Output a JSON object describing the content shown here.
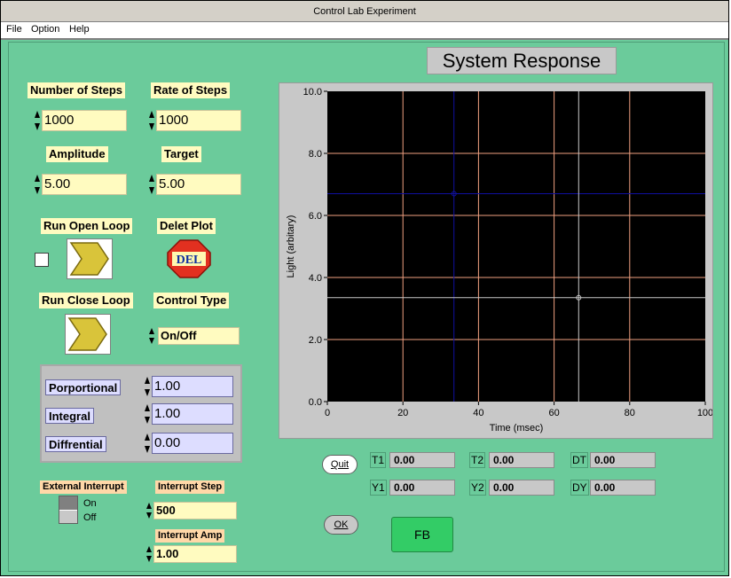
{
  "window": {
    "title": "Control Lab Experiment"
  },
  "menu": [
    "File",
    "Option",
    "Help"
  ],
  "controls": {
    "num_steps": {
      "label": "Number of Steps",
      "value": "1000"
    },
    "rate_steps": {
      "label": "Rate of Steps",
      "value": "1000"
    },
    "amplitude": {
      "label": "Amplitude",
      "value": "5.00"
    },
    "target": {
      "label": "Target",
      "value": "5.00"
    },
    "run_open_loop": {
      "label": "Run Open Loop"
    },
    "delet_plot": {
      "label": "Delet Plot",
      "icon_text": "DEL"
    },
    "run_close_loop": {
      "label": "Run Close Loop"
    },
    "control_type": {
      "label": "Control Type",
      "value": "On/Off"
    },
    "proportional": {
      "label": "Porportional",
      "value": "1.00"
    },
    "integral": {
      "label": "Integral",
      "value": "1.00"
    },
    "differential": {
      "label": "Diffrential",
      "value": "0.00"
    },
    "external_interrupt": {
      "label": "External Interrupt",
      "on_label": "On",
      "off_label": "Off"
    },
    "interrupt_step": {
      "label": "Interrupt Step",
      "value": "500"
    },
    "interrupt_amp": {
      "label": "Interrupt Amp",
      "value": "1.00"
    }
  },
  "buttons": {
    "quit": "Quit",
    "ok": "OK",
    "fb": "FB"
  },
  "cursors": [
    {
      "label": "T1",
      "value": "0.00"
    },
    {
      "label": "T2",
      "value": "0.00"
    },
    {
      "label": "DT",
      "value": "0.00"
    },
    {
      "label": "Y1",
      "value": "0.00"
    },
    {
      "label": "Y2",
      "value": "0.00"
    },
    {
      "label": "DY",
      "value": "0.00"
    }
  ],
  "chart_data": {
    "type": "line",
    "title": "System Response",
    "xlabel": "Time (msec)",
    "ylabel": "Light (arbitary)",
    "xlim": [
      0,
      100
    ],
    "ylim": [
      0,
      10
    ],
    "x_ticks": [
      "0",
      "20",
      "40",
      "60",
      "80",
      "100"
    ],
    "y_ticks": [
      "0.0",
      "2.0",
      "4.0",
      "6.0",
      "8.0",
      "10.0"
    ],
    "grid": true,
    "series": [],
    "cursors": [
      {
        "x": 33.5,
        "y": 6.7,
        "color": "#1010a0"
      },
      {
        "x": 66.5,
        "y": 3.35,
        "color": "#c8c8c8"
      }
    ],
    "colors": {
      "background": "#000000",
      "grid": "#f0a080"
    }
  }
}
